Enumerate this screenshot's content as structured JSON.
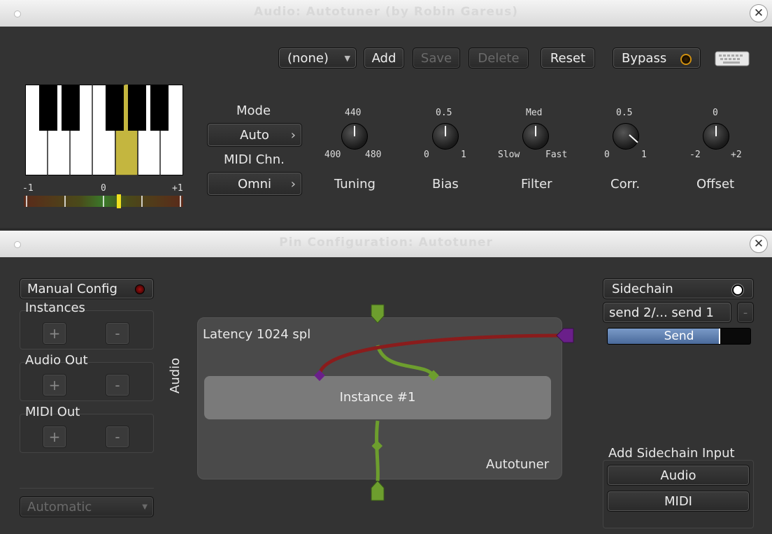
{
  "top_window": {
    "title": "Audio: Autotuner (by Robin Gareus)",
    "preset_select": "(none)",
    "buttons": {
      "add": "Add",
      "save": "Save",
      "delete": "Delete",
      "reset": "Reset",
      "bypass": "Bypass"
    },
    "meter": {
      "min_label": "-1",
      "mid_label": "0",
      "max_label": "+1"
    },
    "mode": {
      "label": "Mode",
      "value": "Auto"
    },
    "midi_channel": {
      "label": "MIDI Chn.",
      "value": "Omni"
    },
    "knobs": [
      {
        "name": "Tuning",
        "top": "440",
        "left": "400",
        "right": "480"
      },
      {
        "name": "Bias",
        "top": "0.5",
        "left": "0",
        "right": "1"
      },
      {
        "name": "Filter",
        "top": "Med",
        "left": "Slow",
        "right": "Fast"
      },
      {
        "name": "Corr.",
        "top": "0.5",
        "left": "0",
        "right": "1"
      },
      {
        "name": "Offset",
        "top": "0",
        "left": "-2",
        "right": "+2"
      }
    ]
  },
  "bottom_window": {
    "title": "Pin Configuration: Autotuner",
    "manual_config": "Manual Config",
    "instances_label": "Instances",
    "audio_out_label": "Audio Out",
    "midi_out_label": "MIDI Out",
    "plus": "+",
    "minus": "-",
    "strategy_select": "Automatic",
    "latency": "Latency 1024 spl",
    "instance": "Instance #1",
    "plugin_name": "Autotuner",
    "input_axis_label": "Audio",
    "sidechain": "Sidechain",
    "send_select": "send 2/... send 1",
    "send_minus": "-",
    "send_label": "Send",
    "send_level": 0.78,
    "add_sidechain_label": "Add Sidechain Input",
    "add_audio": "Audio",
    "add_midi": "MIDI"
  },
  "colors": {
    "audio_wire": "#6d9e2e",
    "midi_wire": "#8a1c1c",
    "midi_port": "#6a1f8a",
    "led_on": "#ffffff",
    "led_off": "#5a0d0d"
  }
}
